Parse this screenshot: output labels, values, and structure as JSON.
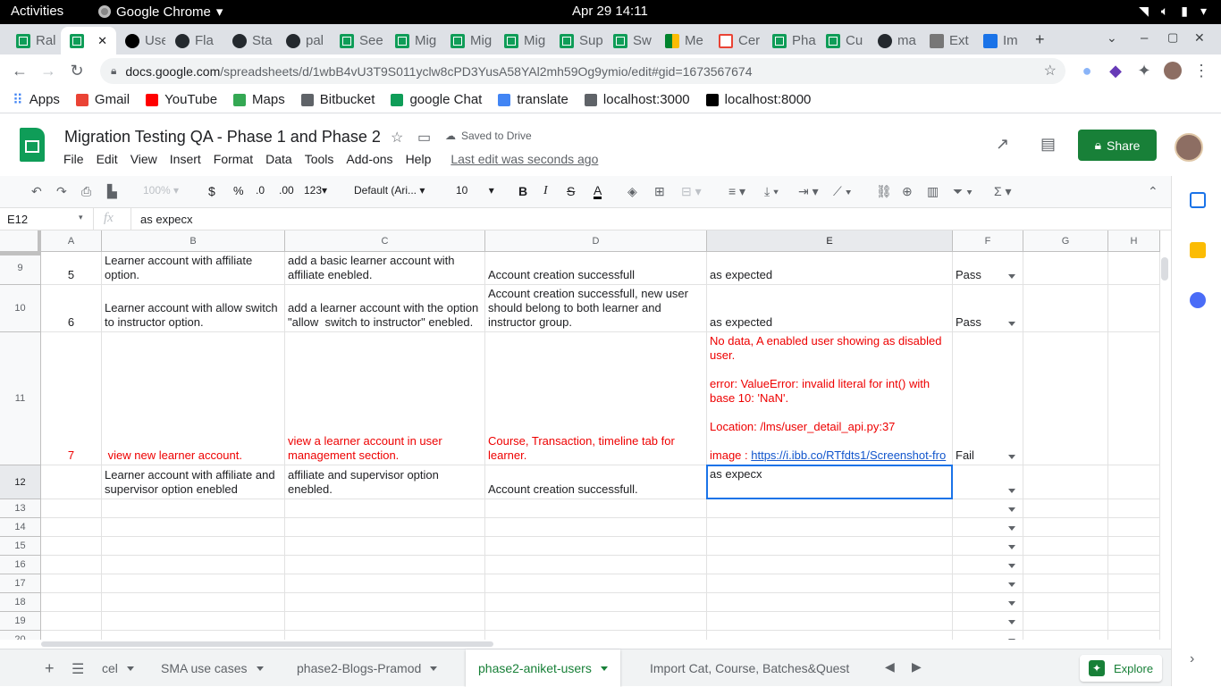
{
  "os": {
    "activities": "Activities",
    "app": "Google Chrome",
    "clock": "Apr 29  14:11"
  },
  "tabs": [
    {
      "label": "Ral",
      "fav": "sheets"
    },
    {
      "label": "",
      "fav": "sheets",
      "active": true
    },
    {
      "label": "Use",
      "fav": "notion"
    },
    {
      "label": "Fla",
      "fav": "gh"
    },
    {
      "label": "Sta",
      "fav": "gh"
    },
    {
      "label": "pal",
      "fav": "gh"
    },
    {
      "label": "See",
      "fav": "sheets"
    },
    {
      "label": "Mig",
      "fav": "sheets"
    },
    {
      "label": "Mig",
      "fav": "sheets"
    },
    {
      "label": "Mig",
      "fav": "sheets"
    },
    {
      "label": "Sup",
      "fav": "sheets"
    },
    {
      "label": "Sw",
      "fav": "sheets"
    },
    {
      "label": "Me",
      "fav": "meet"
    },
    {
      "label": "Cer",
      "fav": "gm"
    },
    {
      "label": "Pha",
      "fav": "sheets"
    },
    {
      "label": "Cu",
      "fav": "sheets"
    },
    {
      "label": "ma",
      "fav": "gh"
    },
    {
      "label": "Ext",
      "fav": "ext"
    },
    {
      "label": "Im",
      "fav": "ibb"
    }
  ],
  "url": {
    "host": "docs.google.com",
    "path": "/spreadsheets/d/1wbB4vU3T9S011yclw8cPD3YusA58YAl2mh59Og9ymio/edit#gid=1673567674"
  },
  "bookmarks": [
    {
      "label": "Apps",
      "color": "#ea4335"
    },
    {
      "label": "Gmail",
      "color": "#ea4335"
    },
    {
      "label": "YouTube",
      "color": "#ff0000"
    },
    {
      "label": "Maps",
      "color": "#34a853"
    },
    {
      "label": "Bitbucket",
      "color": "#5f6368"
    },
    {
      "label": "google Chat",
      "color": "#0f9d58"
    },
    {
      "label": "translate",
      "color": "#4285f4"
    },
    {
      "label": "localhost:3000",
      "color": "#5f6368"
    },
    {
      "label": "localhost:8000",
      "color": "#000000"
    }
  ],
  "doc": {
    "title": "Migration Testing QA - Phase 1 and Phase 2",
    "saved": "Saved to Drive",
    "menus": [
      "File",
      "Edit",
      "View",
      "Insert",
      "Format",
      "Data",
      "Tools",
      "Add-ons",
      "Help"
    ],
    "last_edit": "Last edit was seconds ago",
    "share": "Share"
  },
  "toolbar": {
    "zoom": "100%",
    "currency": "$",
    "percent": "%",
    "dec_less": ".0",
    "dec_more": ".00",
    "format": "123",
    "font": "Default (Ari...",
    "size": "10"
  },
  "formula": {
    "cell_ref": "E12",
    "fx": "fx",
    "value": "as expecx"
  },
  "columns": [
    "A",
    "B",
    "C",
    "D",
    "E",
    "F",
    "G",
    "H"
  ],
  "rows": [
    {
      "num": "9",
      "a": "5",
      "b": "Learner account with affiliate option.",
      "c": "add a basic learner account with affiliate enebled.",
      "d": "Account creation successfull",
      "e": "as expected",
      "f": "Pass"
    },
    {
      "num": "10",
      "a": "6",
      "b": "Learner account with allow switch to instructor option.",
      "c": "add a learner account with the option \"allow  switch to instructor\" enebled.",
      "d": "Account creation successfull, new user should belong to both learner and instructor group.",
      "e": "as expected",
      "f": "Pass"
    },
    {
      "num": "11",
      "a": "7",
      "b": " view new learner account.",
      "c": "view a learner account in user management section.",
      "d": "Course, Transaction, timeline tab for learner.",
      "e_lines": [
        "No data, A enabled user showing as disabled user.",
        "",
        "error: ValueError: invalid literal for int() with base 10: 'NaN'.",
        "",
        "Location: /lms/user_detail_api.py:37",
        ""
      ],
      "e_prefix": "image : ",
      "e_link": "https://i.ibb.co/RTfdts1/Screenshot-fro",
      "f": "Fail",
      "red": true
    },
    {
      "num": "12",
      "a": "",
      "b": "Learner account with affiliate and supervisor option enebled",
      "c": "Create a Learner account with affiliate and supervisor option enebled.",
      "d": "Account creation successfull.",
      "e": "as expecx",
      "f": ""
    },
    {
      "num": "13"
    },
    {
      "num": "14"
    },
    {
      "num": "15"
    },
    {
      "num": "16"
    },
    {
      "num": "17"
    },
    {
      "num": "18"
    },
    {
      "num": "19"
    },
    {
      "num": "20"
    }
  ],
  "sheet_tabs": [
    {
      "label": "cel"
    },
    {
      "label": "SMA use cases"
    },
    {
      "label": "phase2-Blogs-Pramod"
    },
    {
      "label": "phase2-aniket-users",
      "active": true
    },
    {
      "label": "Import Cat, Course, Batches&Quest"
    }
  ],
  "explore": "Explore"
}
